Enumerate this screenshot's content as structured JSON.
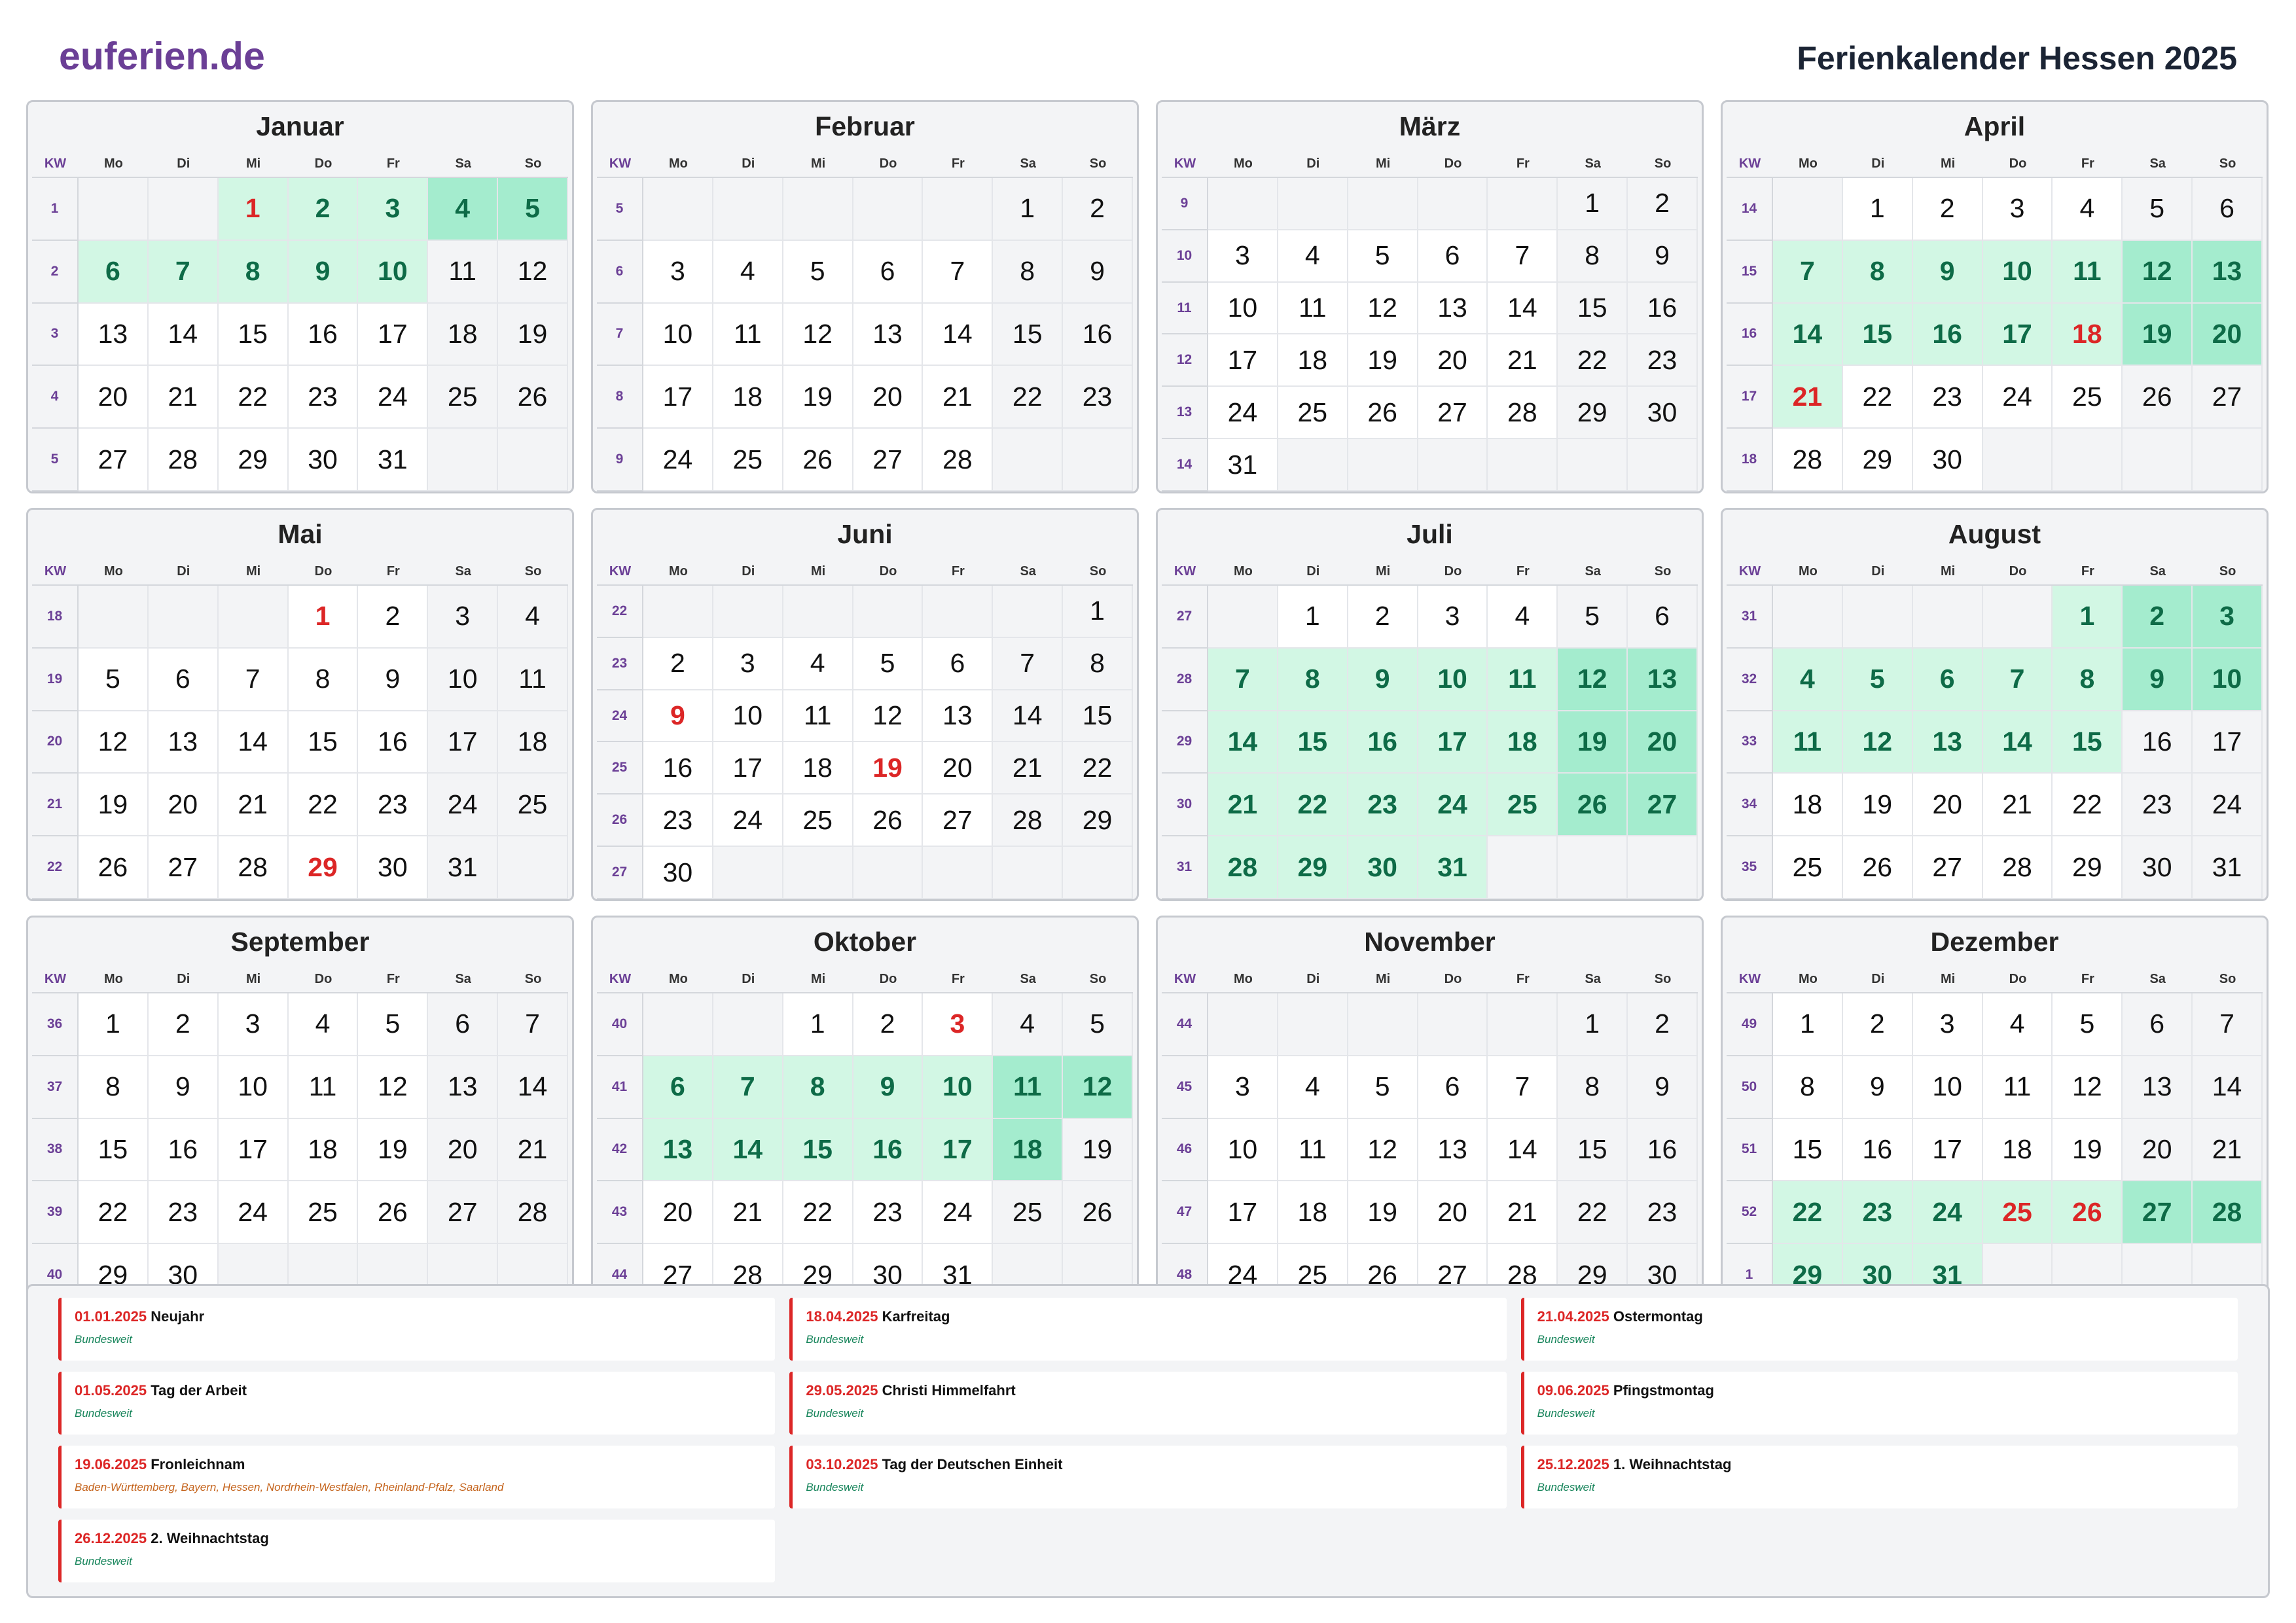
{
  "logo": "euferien.de",
  "title": "Ferienkalender Hessen 2025",
  "weekday_labels": [
    "Mo",
    "Di",
    "Mi",
    "Do",
    "Fr",
    "Sa",
    "So"
  ],
  "kw_label": "KW",
  "colors": {
    "accent": "#6b3f96",
    "holiday": "#dc2626",
    "vacation": "#d2f7e4",
    "vacation_weekend": "#a4ecce",
    "vacation_text": "#0e6b47",
    "weekend": "#f3f4f6"
  },
  "months": [
    {
      "name": "Januar",
      "offset": 2,
      "days": 31,
      "kw": [
        "1",
        "2",
        "3",
        "4",
        "5"
      ],
      "vacation": [
        1,
        2,
        3,
        4,
        5,
        6,
        7,
        8,
        9,
        10
      ],
      "holidays": [
        1
      ]
    },
    {
      "name": "Februar",
      "offset": 5,
      "days": 28,
      "kw": [
        "5",
        "6",
        "7",
        "8",
        "9"
      ],
      "vacation": [],
      "holidays": []
    },
    {
      "name": "März",
      "offset": 5,
      "days": 31,
      "kw": [
        "9",
        "10",
        "11",
        "12",
        "13",
        "14"
      ],
      "vacation": [],
      "holidays": []
    },
    {
      "name": "April",
      "offset": 1,
      "days": 30,
      "kw": [
        "14",
        "15",
        "16",
        "17",
        "18"
      ],
      "vacation": [
        7,
        8,
        9,
        10,
        11,
        12,
        13,
        14,
        15,
        16,
        17,
        18,
        19,
        20,
        21
      ],
      "holidays": [
        18,
        21
      ]
    },
    {
      "name": "Mai",
      "offset": 3,
      "days": 31,
      "kw": [
        "18",
        "19",
        "20",
        "21",
        "22"
      ],
      "vacation": [],
      "holidays": [
        1,
        29
      ]
    },
    {
      "name": "Juni",
      "offset": 6,
      "days": 30,
      "kw": [
        "22",
        "23",
        "24",
        "25",
        "26",
        "27"
      ],
      "vacation": [],
      "holidays": [
        9,
        19
      ]
    },
    {
      "name": "Juli",
      "offset": 1,
      "days": 31,
      "kw": [
        "27",
        "28",
        "29",
        "30",
        "31"
      ],
      "vacation": [
        7,
        8,
        9,
        10,
        11,
        12,
        13,
        14,
        15,
        16,
        17,
        18,
        19,
        20,
        21,
        22,
        23,
        24,
        25,
        26,
        27,
        28,
        29,
        30,
        31
      ],
      "holidays": []
    },
    {
      "name": "August",
      "offset": 4,
      "days": 31,
      "kw": [
        "31",
        "32",
        "33",
        "34",
        "35"
      ],
      "vacation": [
        1,
        2,
        3,
        4,
        5,
        6,
        7,
        8,
        9,
        10,
        11,
        12,
        13,
        14,
        15
      ],
      "holidays": []
    },
    {
      "name": "September",
      "offset": 0,
      "days": 30,
      "kw": [
        "36",
        "37",
        "38",
        "39",
        "40"
      ],
      "vacation": [],
      "holidays": []
    },
    {
      "name": "Oktober",
      "offset": 2,
      "days": 31,
      "kw": [
        "40",
        "41",
        "42",
        "43",
        "44"
      ],
      "vacation": [
        6,
        7,
        8,
        9,
        10,
        11,
        12,
        13,
        14,
        15,
        16,
        17,
        18
      ],
      "holidays": [
        3
      ]
    },
    {
      "name": "November",
      "offset": 5,
      "days": 30,
      "kw": [
        "44",
        "45",
        "46",
        "47",
        "48"
      ],
      "vacation": [],
      "holidays": []
    },
    {
      "name": "Dezember",
      "offset": 0,
      "days": 31,
      "kw": [
        "49",
        "50",
        "51",
        "52",
        "1"
      ],
      "vacation": [
        22,
        23,
        24,
        25,
        26,
        27,
        28,
        29,
        30,
        31
      ],
      "holidays": [
        25,
        26
      ]
    }
  ],
  "holidays_list": [
    {
      "date": "01.01.2025",
      "name": "Neujahr",
      "region": "Bundesweit",
      "regional": false
    },
    {
      "date": "18.04.2025",
      "name": "Karfreitag",
      "region": "Bundesweit",
      "regional": false
    },
    {
      "date": "21.04.2025",
      "name": "Ostermontag",
      "region": "Bundesweit",
      "regional": false
    },
    {
      "date": "01.05.2025",
      "name": "Tag der Arbeit",
      "region": "Bundesweit",
      "regional": false
    },
    {
      "date": "29.05.2025",
      "name": "Christi Himmelfahrt",
      "region": "Bundesweit",
      "regional": false
    },
    {
      "date": "09.06.2025",
      "name": "Pfingstmontag",
      "region": "Bundesweit",
      "regional": false
    },
    {
      "date": "19.06.2025",
      "name": "Fronleichnam",
      "region": "Baden-Württemberg, Bayern, Hessen, Nordrhein-Westfalen, Rheinland-Pfalz, Saarland",
      "regional": true
    },
    {
      "date": "03.10.2025",
      "name": "Tag der Deutschen Einheit",
      "region": "Bundesweit",
      "regional": false
    },
    {
      "date": "25.12.2025",
      "name": "1. Weihnachtstag",
      "region": "Bundesweit",
      "regional": false
    },
    {
      "date": "26.12.2025",
      "name": "2. Weihnachtstag",
      "region": "Bundesweit",
      "regional": false
    }
  ]
}
